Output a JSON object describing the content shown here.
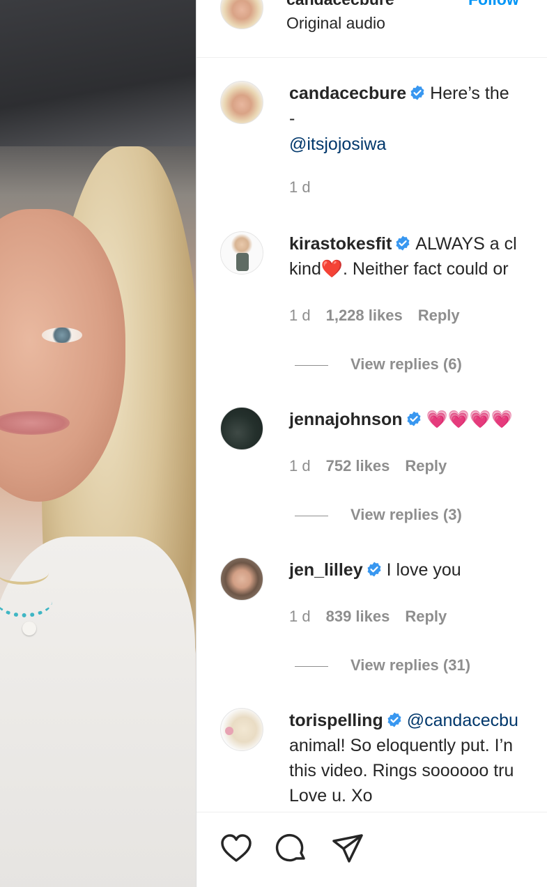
{
  "header": {
    "username": "candacecbure",
    "follow_label": "Follow",
    "audio": "Original audio"
  },
  "comments": [
    {
      "username": "candacecbure",
      "text_line1": "Here’s the",
      "text_line2": "-",
      "mention": "@itsjojosiwa",
      "time": "1 d"
    },
    {
      "username": "kirastokesfit",
      "text_line1": "ALWAYS a cl",
      "text_line2_pre": "kind",
      "text_line2_emoji": "❤️",
      "text_line2_post": ". Neither fact could or",
      "time": "1 d",
      "likes": "1,228 likes",
      "reply": "Reply",
      "view_replies": "View replies (6)"
    },
    {
      "username": "jennajohnson",
      "text_line1": "💗💗💗💗",
      "time": "1 d",
      "likes": "752 likes",
      "reply": "Reply",
      "view_replies": "View replies (3)"
    },
    {
      "username": "jen_lilley",
      "text_line1": "I love you",
      "time": "1 d",
      "likes": "839 likes",
      "reply": "Reply",
      "view_replies": "View replies (31)"
    },
    {
      "username": "torispelling",
      "mention": "@candacecbu",
      "text_line2": "animal! So eloquently put. I’n",
      "text_line3": "this video. Rings soooooo tru",
      "text_line4": "Love u. Xo"
    }
  ],
  "icons": {
    "like": "heart-icon",
    "comment": "comment-icon",
    "share": "send-icon",
    "verified": "verified-badge-icon"
  },
  "colors": {
    "link": "#00376b",
    "verified": "#3897f0",
    "meta": "#8e8e8e",
    "follow": "#0095f6"
  }
}
